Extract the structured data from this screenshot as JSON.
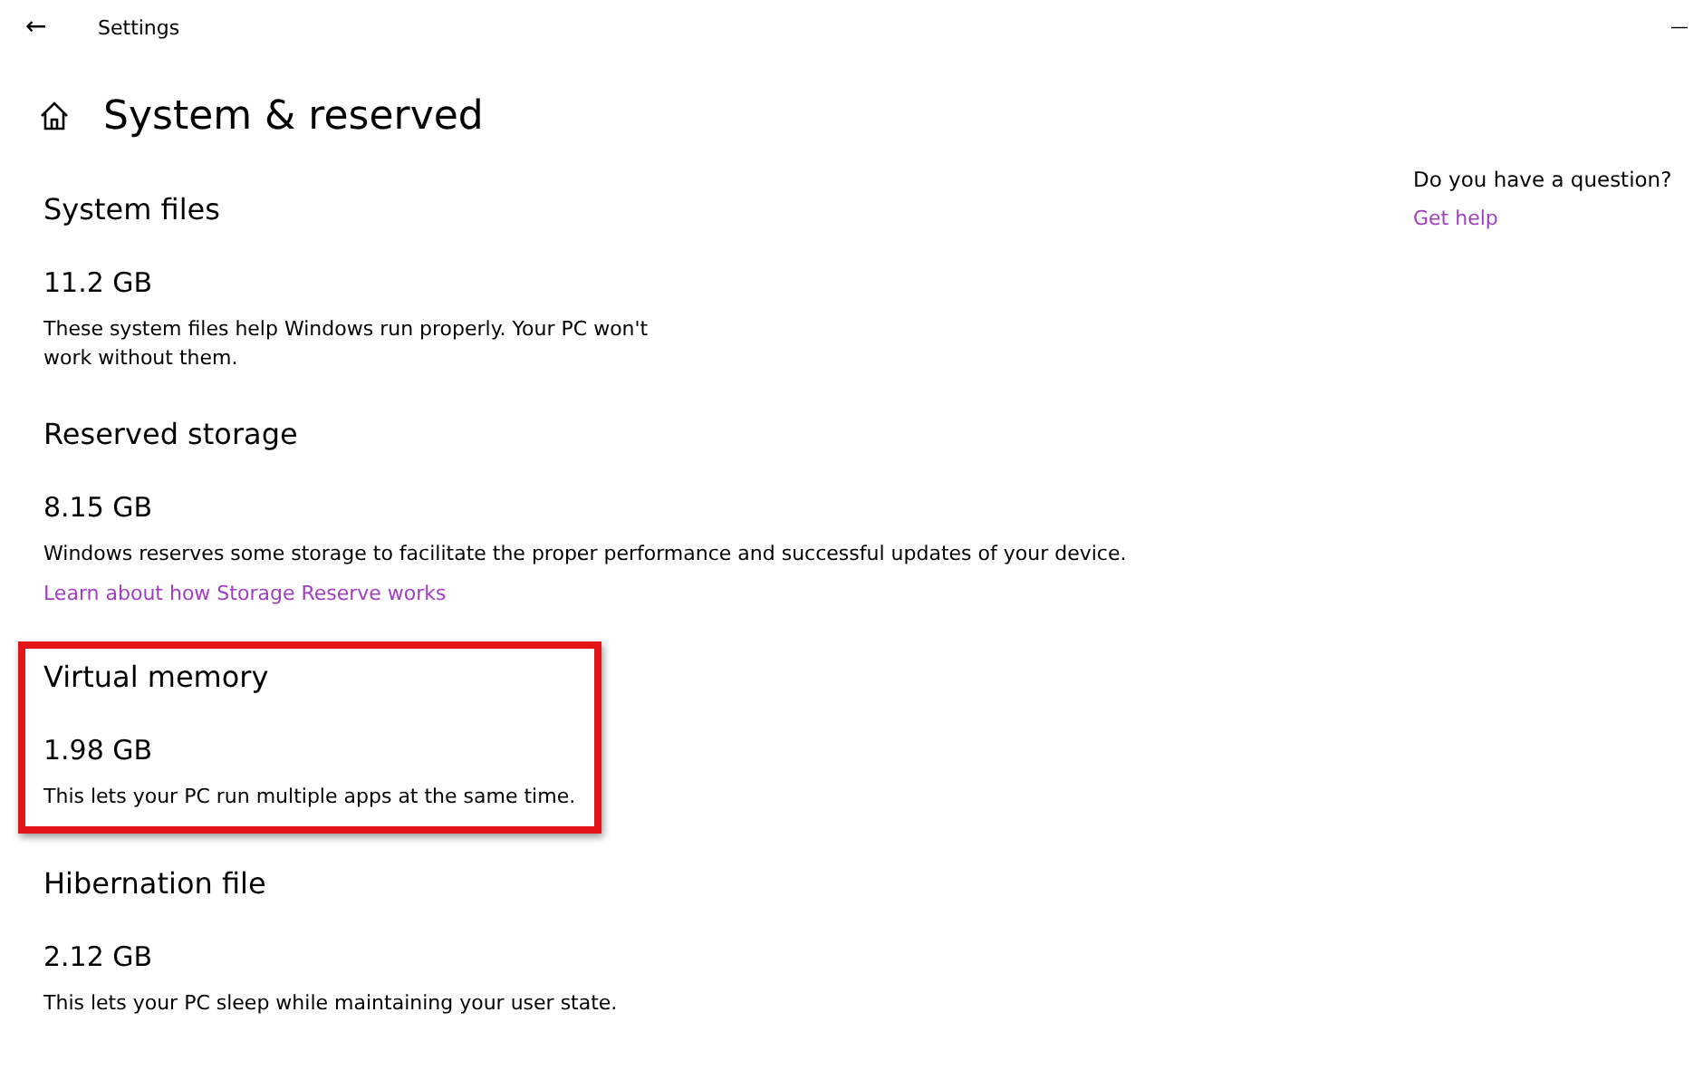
{
  "window": {
    "title": "Settings",
    "back": "←",
    "minimize": "—"
  },
  "page": {
    "title": "System & reserved"
  },
  "sections": [
    {
      "heading": "System files",
      "value": "11.2 GB",
      "description": "These system files help Windows run properly. Your PC won't work without them.",
      "highlighted": false
    },
    {
      "heading": "Reserved storage",
      "value": "8.15 GB",
      "description": "Windows reserves some storage to facilitate the proper performance and successful updates of your device.",
      "link": "Learn about how Storage Reserve works",
      "highlighted": false
    },
    {
      "heading": "Virtual memory",
      "value": "1.98 GB",
      "description": "This lets your PC run multiple apps at the same time.",
      "highlighted": true
    },
    {
      "heading": "Hibernation file",
      "value": "2.12 GB",
      "description": "This lets your PC sleep while maintaining your user state.",
      "highlighted": false
    }
  ],
  "help": {
    "question": "Do you have a question?",
    "link": "Get help"
  }
}
